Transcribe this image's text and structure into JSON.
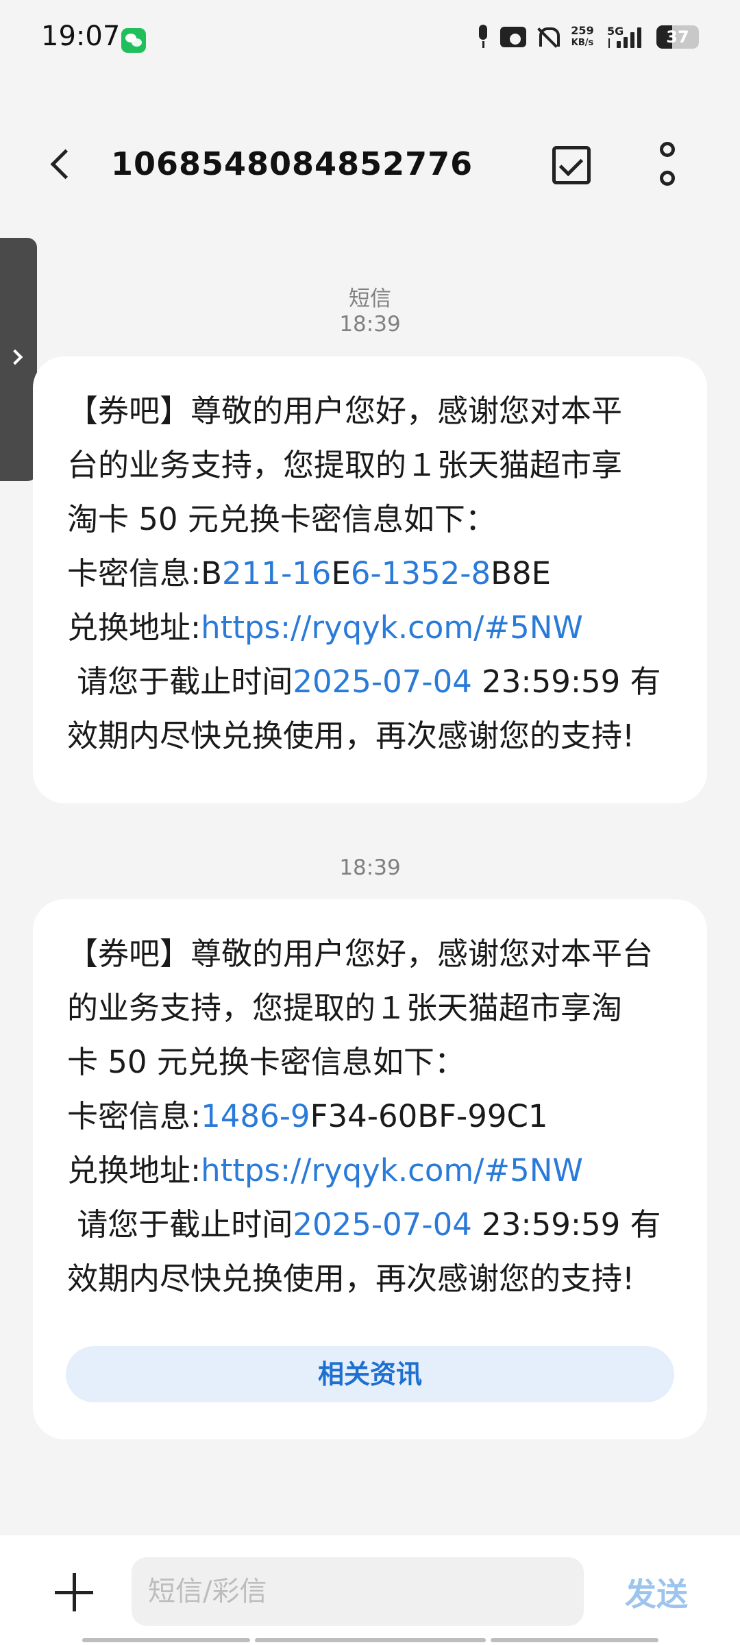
{
  "status_bar": {
    "time": "19:07",
    "net_speed_value": "259",
    "net_speed_unit": "KB/s",
    "network_type": "5G",
    "battery_level": "37",
    "battery_fraction": 0.37,
    "icons": [
      "wechat-icon",
      "mic-icon",
      "camera-icon",
      "mute-icon",
      "signal-icon",
      "battery-icon"
    ]
  },
  "header": {
    "title": "1068548084852776"
  },
  "conversation": {
    "channel_label": "短信",
    "messages": [
      {
        "time": "18:39",
        "line1": "【券吧】尊敬的用户您好，感谢您对本平",
        "line2": "台的业务支持，您提取的１张天猫超市享",
        "line3": "淘卡 50 元兑换卡密信息如下：",
        "code_label": "卡密信息:",
        "code_parts": [
          "B",
          "211-16",
          "E",
          "6-1352-8",
          "B8E"
        ],
        "address_label": "兑换地址:",
        "address_link": "https://ryqyk.com/#5NW",
        "deadline_prefix": " 请您于截止时间",
        "deadline_date": "2025-07-04",
        "deadline_time": " 23:59:59 有",
        "closing": "效期内尽快兑换使用，再次感谢您的支持!"
      },
      {
        "time": "18:39",
        "line1": "【券吧】尊敬的用户您好，感谢您对本平台",
        "line2": "的业务支持，您提取的１张天猫超市享淘",
        "line3": "卡 50 元兑换卡密信息如下：",
        "code_label": "卡密信息:",
        "code_parts": [
          "1486-9",
          "F34-60BF-99C1"
        ],
        "address_label": "兑换地址:",
        "address_link": "https://ryqyk.com/#5NW",
        "deadline_prefix": " 请您于截止时间",
        "deadline_date": "2025-07-04",
        "deadline_time": " 23:59:59 有",
        "closing": "效期内尽快兑换使用，再次感谢您的支持!",
        "related_button": "相关资讯"
      }
    ]
  },
  "input_bar": {
    "placeholder": "短信/彩信",
    "send_label": "发送"
  }
}
